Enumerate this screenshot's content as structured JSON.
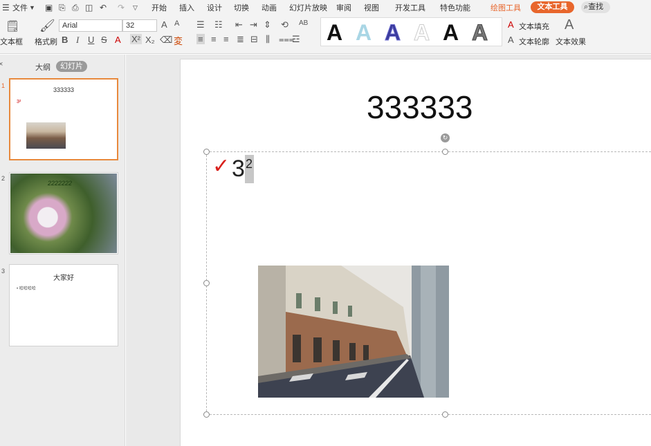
{
  "menu": {
    "file": "文件",
    "tabs": [
      "开始",
      "插入",
      "设计",
      "切换",
      "动画",
      "幻灯片放映",
      "审阅",
      "视图",
      "开发工具",
      "特色功能"
    ],
    "drawing_tools": "绘图工具",
    "text_tools": "文本工具",
    "search": "查找"
  },
  "ribbon": {
    "textbox_label": "文本框",
    "format_painter": "格式刷",
    "font_name": "Arial",
    "font_size": "32",
    "text_fill": "文本填充",
    "text_outline": "文本轮廓",
    "text_effect": "文本效果",
    "style_letter": "A"
  },
  "left_pane": {
    "tab_outline": "大纲",
    "tab_slides": "幻灯片",
    "slides": [
      {
        "num": "1",
        "title": "333333",
        "bullet": "3²"
      },
      {
        "num": "2",
        "title": "2222222"
      },
      {
        "num": "3",
        "title": "大家好",
        "bullet": "哈哈哈哈"
      }
    ]
  },
  "slide": {
    "title": "333333",
    "body_base": "3",
    "body_sup": "2"
  },
  "colors": {
    "accent": "#e8662c",
    "check": "#d9201c"
  }
}
